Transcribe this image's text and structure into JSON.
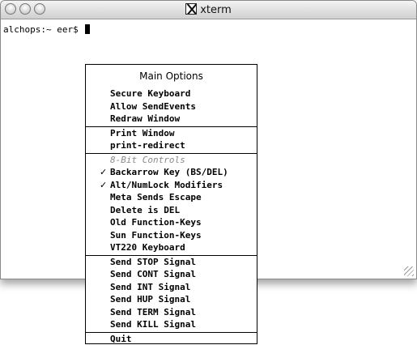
{
  "window": {
    "title": "xterm"
  },
  "terminal": {
    "prompt": "alchops:~ eer$"
  },
  "menu": {
    "title": "Main Options",
    "groups": [
      [
        {
          "label": "Secure Keyboard",
          "checked": false,
          "enabled": true
        },
        {
          "label": "Allow SendEvents",
          "checked": false,
          "enabled": true
        },
        {
          "label": "Redraw Window",
          "checked": false,
          "enabled": true
        }
      ],
      [
        {
          "label": "Print Window",
          "checked": false,
          "enabled": true
        },
        {
          "label": "print-redirect",
          "checked": false,
          "enabled": true
        }
      ],
      [
        {
          "label": "8-Bit Controls",
          "checked": false,
          "enabled": false
        },
        {
          "label": "Backarrow Key (BS/DEL)",
          "checked": true,
          "enabled": true
        },
        {
          "label": "Alt/NumLock Modifiers",
          "checked": true,
          "enabled": true
        },
        {
          "label": "Meta Sends Escape",
          "checked": false,
          "enabled": true
        },
        {
          "label": "Delete is DEL",
          "checked": false,
          "enabled": true
        },
        {
          "label": "Old Function-Keys",
          "checked": false,
          "enabled": true
        },
        {
          "label": "Sun Function-Keys",
          "checked": false,
          "enabled": true
        },
        {
          "label": "VT220 Keyboard",
          "checked": false,
          "enabled": true
        }
      ],
      [
        {
          "label": "Send STOP Signal",
          "checked": false,
          "enabled": true
        },
        {
          "label": "Send CONT Signal",
          "checked": false,
          "enabled": true
        },
        {
          "label": "Send INT Signal",
          "checked": false,
          "enabled": true
        },
        {
          "label": "Send HUP Signal",
          "checked": false,
          "enabled": true
        },
        {
          "label": "Send TERM Signal",
          "checked": false,
          "enabled": true
        },
        {
          "label": "Send KILL Signal",
          "checked": false,
          "enabled": true
        }
      ],
      [
        {
          "label": "Quit",
          "checked": false,
          "enabled": true
        }
      ]
    ]
  },
  "icons": {
    "window_controls": [
      "close-button-icon",
      "minimize-button-icon",
      "zoom-button-icon"
    ],
    "title_icon": "x11-logo-icon",
    "checkmark": "checkmark-icon",
    "cursor": "block-cursor",
    "resize": "resize-grip-icon"
  }
}
